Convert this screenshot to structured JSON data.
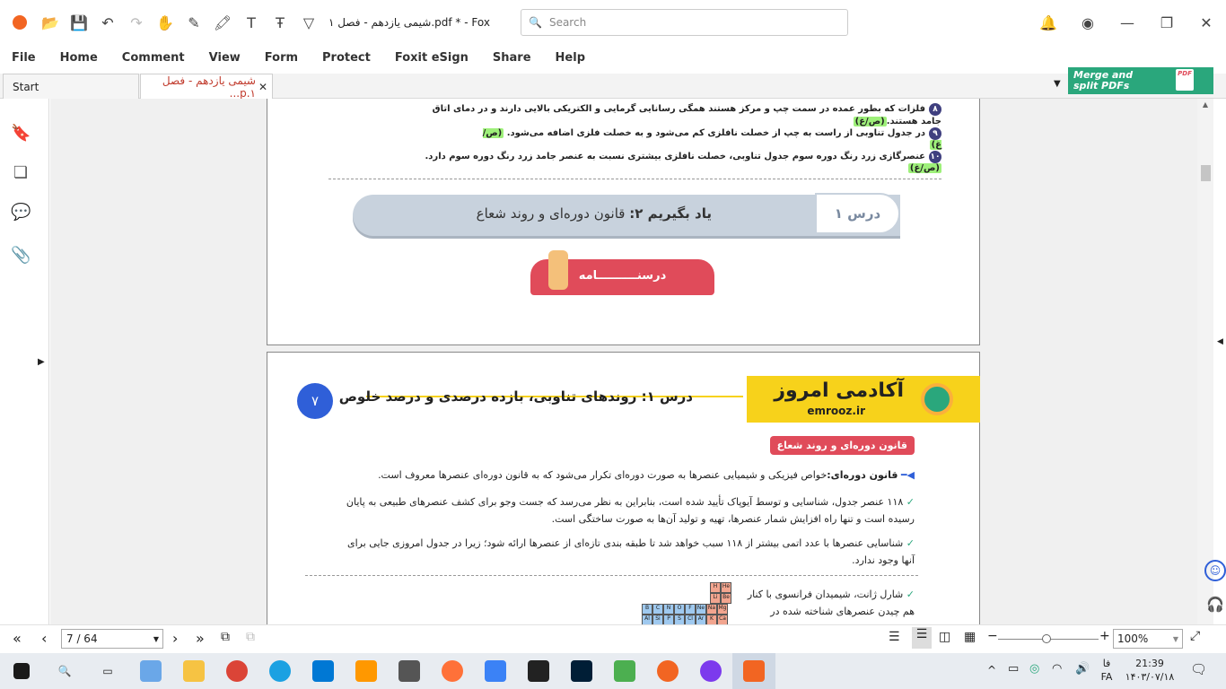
{
  "window": {
    "title": "شیمی یازدهم - فصل ۱.pdf * - Foxit P..."
  },
  "search": {
    "placeholder": "Search"
  },
  "menu": [
    "File",
    "Home",
    "Comment",
    "View",
    "Form",
    "Protect",
    "Foxit eSign",
    "Share",
    "Help"
  ],
  "tabs": [
    {
      "label": "Start"
    },
    {
      "label": "شیمی یازدهم - فصل ۱.p..."
    }
  ],
  "banner": {
    "line1": "Merge and",
    "line2": "split PDFs"
  },
  "page1": {
    "items": [
      {
        "num": "۸",
        "text": "فلزات که بطور عمده در سمت چپ و مرکز هستند همگی رسانایی گرمایی و الکتریکی بالایی دارند و در دمای اتاق جامد هستند.",
        "ans": "(ص/غ)"
      },
      {
        "num": "۹",
        "text": "در جدول تناوبی از راست به چپ از خصلت نافلزی کم می‌شود و به خصلت فلزی اضافه می‌شود.",
        "ans": "(ص/غ)"
      },
      {
        "num": "۱۰",
        "text": "عنصرگازی زرد رنگ دوره سوم جدول تناوبی، خصلت نافلزی بیشتری نسبت به عنصر جامد زرد رنگ دوره سوم  دارد.",
        "ans": "(ص/غ)"
      }
    ],
    "lesson_label": "درس ۱",
    "lesson_title_bold": "یاد بگیریم ۲:",
    "lesson_title": "قانون دوره‌ای و روند شعاع",
    "darsname": "درسنــــــــــامه"
  },
  "page2": {
    "page_num": "۷",
    "header_title": "درس ۱: روندهای تناوبی، بازده درصدی و درصد خلوص",
    "logo_text": "آکادمی امروز",
    "logo_sub": "emrooz.ir",
    "section": "قانون دوره‌ای و روند شعاع",
    "def_bold": "قانون دوره‌ای:",
    "def_text": "خواص فیزیکی و شیمیایی عنصرها به صورت دوره‌ای تکرار می‌شود که به قانون دوره‌ای عنصرها معروف است.",
    "para1": "۱۱۸ عنصر جدول، شناسایی و توسط آیوپاک تأیید شده است، بنابراین به نظر می‌رسد که جست وجو برای کشف عنصرهای طبیعی به پایان رسیده است و تنها راه افزایش شمار عنصرها، تهیه و تولید آن‌ها به صورت ساختگی است.",
    "para2": "شناسایی عنصرها با عدد اتمی بیشتر از ۱۱۸ سبب خواهد شد تا طبقه بندی تازه‌ای از عنصرها ارائه شود؛ زیرا در جدول امروزی جایی برای آنها وجود ندارد.",
    "para3a": "شارل ژانت، شیمیدان فرانسوی با کنار",
    "para3b": "هم چیدن عنصرهای شناخته شده در",
    "mini_row1": [
      "He",
      "H"
    ],
    "mini_row2": [
      "Be",
      "Li"
    ],
    "mini_row3": [
      "B",
      "C",
      "N",
      "O",
      "F",
      "Ne",
      "Na",
      "Mg"
    ],
    "mini_row4": [
      "Al",
      "Si",
      "P",
      "S",
      "Cl",
      "Ar",
      "K",
      "Ca"
    ]
  },
  "status": {
    "page": "7 / 64",
    "zoom": "100%"
  },
  "tray": {
    "lang_top": "فا",
    "lang": "FA",
    "time": "21:39",
    "date": "۱۴۰۳/۰۷/۱۸"
  },
  "colors": {
    "accent": "#f26522",
    "banner": "#2aa77c",
    "yellow": "#f7d21b",
    "pink": "#e04b5a",
    "blue": "#2f5fd8"
  }
}
